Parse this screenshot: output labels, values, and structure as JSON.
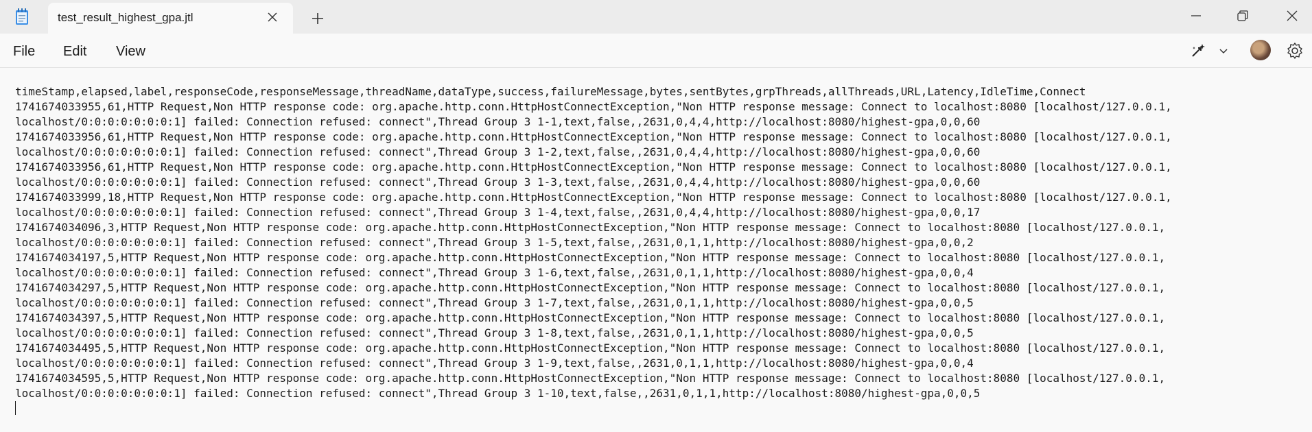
{
  "window": {
    "tab_title": "test_result_highest_gpa.jtl"
  },
  "menu": {
    "file": "File",
    "edit": "Edit",
    "view": "View"
  },
  "icons": {
    "app": "notepad-icon",
    "tab_close": "close-icon",
    "new_tab": "plus-icon",
    "minimize": "minimize-icon",
    "maximize": "restore-icon",
    "close": "close-icon",
    "copilot": "copilot-icon",
    "dropdown": "chevron-down-icon",
    "settings": "gear-icon"
  },
  "document": {
    "content": "timeStamp,elapsed,label,responseCode,responseMessage,threadName,dataType,success,failureMessage,bytes,sentBytes,grpThreads,allThreads,URL,Latency,IdleTime,Connect\n1741674033955,61,HTTP Request,Non HTTP response code: org.apache.http.conn.HttpHostConnectException,\"Non HTTP response message: Connect to localhost:8080 [localhost/127.0.0.1,\nlocalhost/0:0:0:0:0:0:0:1] failed: Connection refused: connect\",Thread Group 3 1-1,text,false,,2631,0,4,4,http://localhost:8080/highest-gpa,0,0,60\n1741674033956,61,HTTP Request,Non HTTP response code: org.apache.http.conn.HttpHostConnectException,\"Non HTTP response message: Connect to localhost:8080 [localhost/127.0.0.1,\nlocalhost/0:0:0:0:0:0:0:1] failed: Connection refused: connect\",Thread Group 3 1-2,text,false,,2631,0,4,4,http://localhost:8080/highest-gpa,0,0,60\n1741674033956,61,HTTP Request,Non HTTP response code: org.apache.http.conn.HttpHostConnectException,\"Non HTTP response message: Connect to localhost:8080 [localhost/127.0.0.1,\nlocalhost/0:0:0:0:0:0:0:1] failed: Connection refused: connect\",Thread Group 3 1-3,text,false,,2631,0,4,4,http://localhost:8080/highest-gpa,0,0,60\n1741674033999,18,HTTP Request,Non HTTP response code: org.apache.http.conn.HttpHostConnectException,\"Non HTTP response message: Connect to localhost:8080 [localhost/127.0.0.1,\nlocalhost/0:0:0:0:0:0:0:1] failed: Connection refused: connect\",Thread Group 3 1-4,text,false,,2631,0,4,4,http://localhost:8080/highest-gpa,0,0,17\n1741674034096,3,HTTP Request,Non HTTP response code: org.apache.http.conn.HttpHostConnectException,\"Non HTTP response message: Connect to localhost:8080 [localhost/127.0.0.1,\nlocalhost/0:0:0:0:0:0:0:1] failed: Connection refused: connect\",Thread Group 3 1-5,text,false,,2631,0,1,1,http://localhost:8080/highest-gpa,0,0,2\n1741674034197,5,HTTP Request,Non HTTP response code: org.apache.http.conn.HttpHostConnectException,\"Non HTTP response message: Connect to localhost:8080 [localhost/127.0.0.1,\nlocalhost/0:0:0:0:0:0:0:1] failed: Connection refused: connect\",Thread Group 3 1-6,text,false,,2631,0,1,1,http://localhost:8080/highest-gpa,0,0,4\n1741674034297,5,HTTP Request,Non HTTP response code: org.apache.http.conn.HttpHostConnectException,\"Non HTTP response message: Connect to localhost:8080 [localhost/127.0.0.1,\nlocalhost/0:0:0:0:0:0:0:1] failed: Connection refused: connect\",Thread Group 3 1-7,text,false,,2631,0,1,1,http://localhost:8080/highest-gpa,0,0,5\n1741674034397,5,HTTP Request,Non HTTP response code: org.apache.http.conn.HttpHostConnectException,\"Non HTTP response message: Connect to localhost:8080 [localhost/127.0.0.1,\nlocalhost/0:0:0:0:0:0:0:1] failed: Connection refused: connect\",Thread Group 3 1-8,text,false,,2631,0,1,1,http://localhost:8080/highest-gpa,0,0,5\n1741674034495,5,HTTP Request,Non HTTP response code: org.apache.http.conn.HttpHostConnectException,\"Non HTTP response message: Connect to localhost:8080 [localhost/127.0.0.1,\nlocalhost/0:0:0:0:0:0:0:1] failed: Connection refused: connect\",Thread Group 3 1-9,text,false,,2631,0,1,1,http://localhost:8080/highest-gpa,0,0,4\n1741674034595,5,HTTP Request,Non HTTP response code: org.apache.http.conn.HttpHostConnectException,\"Non HTTP response message: Connect to localhost:8080 [localhost/127.0.0.1,\nlocalhost/0:0:0:0:0:0:0:1] failed: Connection refused: connect\",Thread Group 3 1-10,text,false,,2631,0,1,1,http://localhost:8080/highest-gpa,0,0,5"
  }
}
